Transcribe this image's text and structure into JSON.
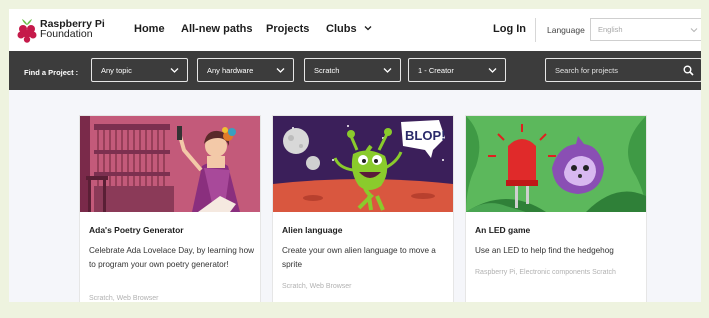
{
  "header": {
    "brand_line1": "Raspberry Pi",
    "brand_line2": "Foundation",
    "nav": [
      {
        "label": "Home"
      },
      {
        "label": "All-new paths"
      },
      {
        "label": "Projects"
      },
      {
        "label": "Clubs"
      }
    ],
    "login_label": "Log In",
    "language_label": "Language",
    "language_value": "English"
  },
  "filters": {
    "label": "Find a Project :",
    "topic": "Any topic",
    "hardware": "Any hardware",
    "software": "Scratch",
    "level": "1 - Creator",
    "search_placeholder": "Search for projects"
  },
  "cards": [
    {
      "title": "Ada's Poetry Generator",
      "description": "Celebrate Ada Lovelace Day, by learning how to program your own poetry generator!",
      "meta": "Scratch, Web Browser"
    },
    {
      "title": "Alien language",
      "description": "Create your own alien language to move a sprite",
      "meta": "Scratch, Web Browser",
      "image_text": "BLOP!"
    },
    {
      "title": "An LED game",
      "description": "Use an LED to help find the hedgehog",
      "meta": "Raspberry Pi, Electronic components Scratch"
    }
  ],
  "colors": {
    "filter_bar": "#3c3c3c",
    "page_bg": "#f5f6fa",
    "brand_red": "#c51a4a",
    "brand_green": "#6cc04a"
  }
}
